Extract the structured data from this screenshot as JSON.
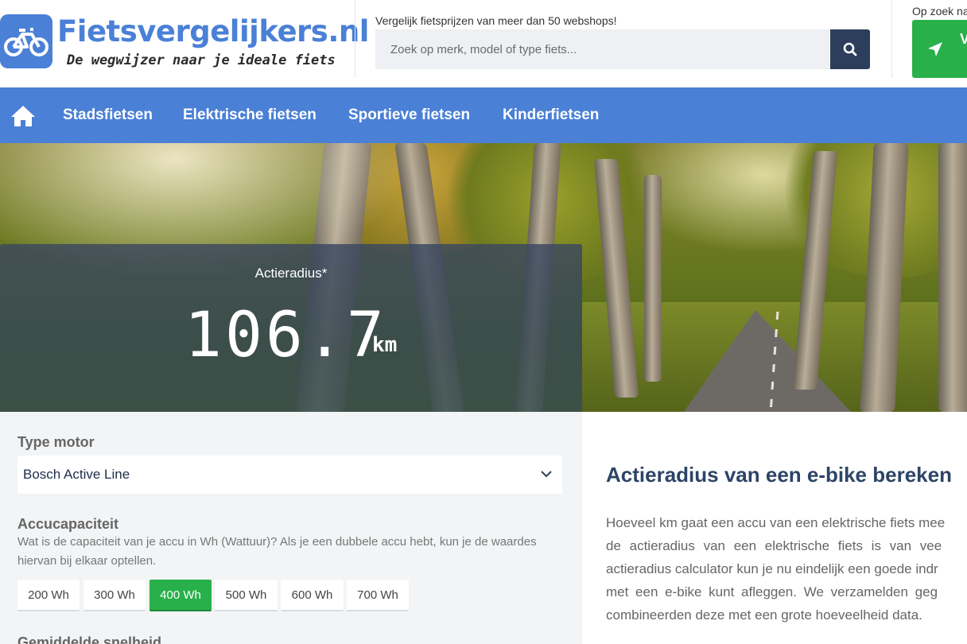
{
  "header": {
    "logo_title": "Fietsvergelijkers.nl",
    "logo_tagline": "De wegwijzer naar je ideale fiets",
    "search_caption": "Vergelijk fietsprijzen van meer dan 50 webshops!",
    "search_placeholder": "Zoek op merk, model of type fiets...",
    "find_caption": "Op zoek na",
    "find_button_label": "V",
    "colors": {
      "brand": "#4a80d6",
      "search_button": "#2d3e5c",
      "cta": "#28b04a"
    },
    "icons": [
      "bike-logo-icon",
      "search-icon",
      "navigation-arrow-icon"
    ]
  },
  "nav": {
    "home_icon": "home-icon",
    "items": [
      {
        "label": "Stadsfietsen"
      },
      {
        "label": "Elektrische fietsen"
      },
      {
        "label": "Sportieve fietsen"
      },
      {
        "label": "Kinderfietsen"
      }
    ]
  },
  "hero": {
    "range_label": "Actieradius*",
    "range_value": "106.7",
    "range_unit": "km"
  },
  "calculator": {
    "motor_label": "Type motor",
    "motor_selected": "Bosch Active Line",
    "battery_label": "Accucapaciteit",
    "battery_help": "Wat is de capaciteit van je accu in Wh (Wattuur)? Als je een dubbele accu hebt, kun je de waardes hiervan bij elkaar optellen.",
    "battery_options": [
      {
        "label": "200 Wh",
        "active": false
      },
      {
        "label": "300 Wh",
        "active": false
      },
      {
        "label": "400 Wh",
        "active": true
      },
      {
        "label": "500 Wh",
        "active": false
      },
      {
        "label": "600 Wh",
        "active": false
      },
      {
        "label": "700 Wh",
        "active": false
      }
    ],
    "speed_label": "Gemiddelde snelheid"
  },
  "article": {
    "heading": "Actieradius van een e-bike bereken",
    "lines": [
      "Hoeveel km gaat een accu van een elektrische fiets mee",
      "de actieradius van een elektrische fiets is van vee",
      "actieradius calculator kun je nu eindelijk een goede indr",
      "met een e-bike kunt afleggen. We verzamelden geg",
      "combineerden deze met een grote hoeveelheid data."
    ]
  }
}
